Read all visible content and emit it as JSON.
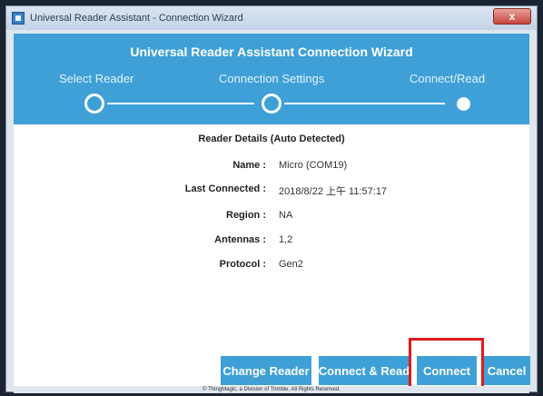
{
  "window": {
    "title": "Universal Reader Assistant - Connection Wizard",
    "close_label": "x"
  },
  "wizard": {
    "title": "Universal Reader Assistant Connection Wizard",
    "steps": [
      {
        "label": "Select Reader",
        "state": "complete"
      },
      {
        "label": "Connection Settings",
        "state": "complete"
      },
      {
        "label": "Connect/Read",
        "state": "current"
      }
    ]
  },
  "details": {
    "heading": "Reader Details (Auto Detected)",
    "rows": [
      {
        "key": "Name :",
        "value": "Micro (COM19)"
      },
      {
        "key": "Last Connected :",
        "value": "2018/8/22 上午 11:57:17"
      },
      {
        "key": "Region :",
        "value": "NA"
      },
      {
        "key": "Antennas :",
        "value": "1,2"
      },
      {
        "key": "Protocol :",
        "value": "Gen2"
      }
    ]
  },
  "buttons": {
    "change_reader": "Change Reader",
    "connect_read": "Connect & Read",
    "connect": "Connect",
    "cancel": "Cancel"
  },
  "highlight_color": "#e01b1b",
  "accent_color": "#3ea0d6",
  "footer": "© ThingMagic, a Division of Trimble, All Rights Reserved."
}
